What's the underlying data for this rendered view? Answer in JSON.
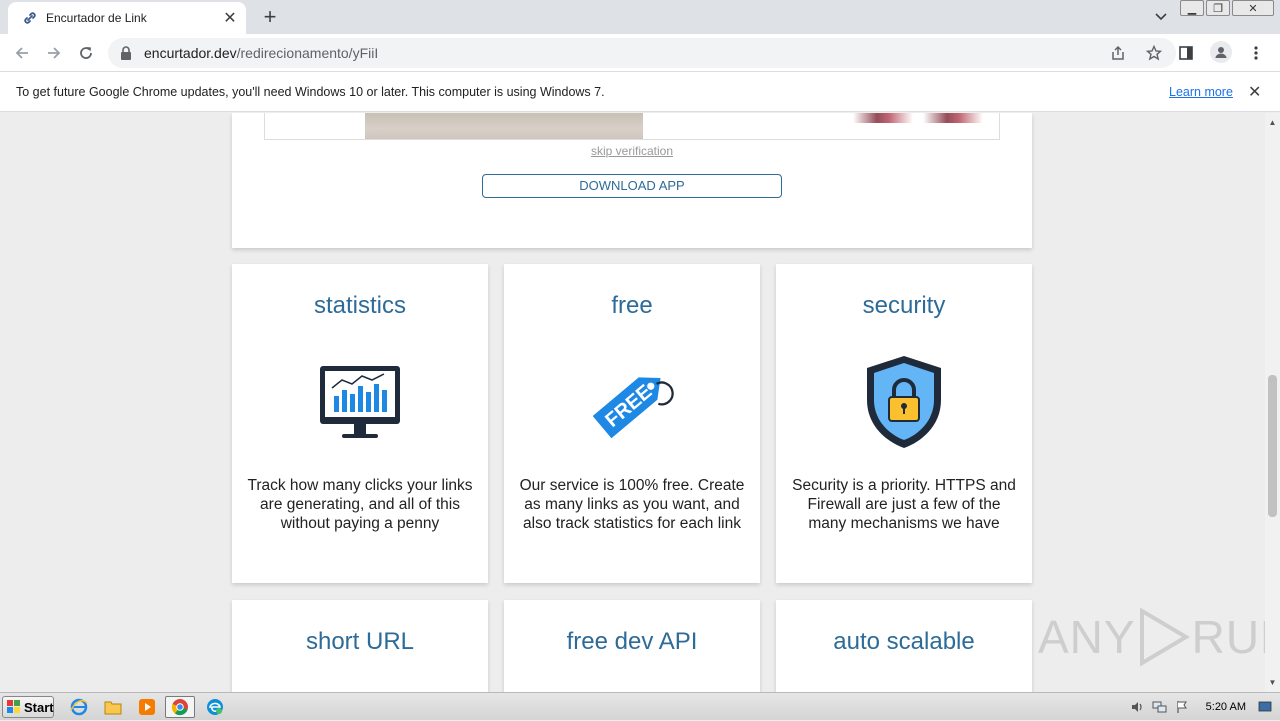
{
  "browser": {
    "tab_title": "Encurtador de Link",
    "url_host": "encurtador.dev",
    "url_path": "/redirecionamento/yFiiI",
    "info_message": "To get future Google Chrome updates, you'll need Windows 10 or later. This computer is using Windows 7.",
    "learn_more": "Learn more"
  },
  "page": {
    "skip_link": "skip verification",
    "download_button": "DOWNLOAD APP",
    "features": [
      {
        "title": "statistics",
        "description": "Track how many clicks your links are generating, and all of this without paying a penny",
        "icon": "monitor-chart-icon"
      },
      {
        "title": "free",
        "description": "Our service is 100% free. Create as many links as you want, and also track statistics for each link",
        "icon": "free-tag-icon",
        "icon_text": "FREE"
      },
      {
        "title": "security",
        "description": "Security is a priority. HTTPS and Firewall are just a few of the many mechanisms we have",
        "icon": "shield-lock-icon"
      },
      {
        "title": "short URL",
        "icon": "link-icon"
      },
      {
        "title": "free dev API",
        "icon": "api-icon"
      },
      {
        "title": "auto scalable",
        "icon": "scale-icon"
      }
    ],
    "accent_color": "#2d6b98"
  },
  "watermark": {
    "left": "ANY",
    "right": "RUN"
  },
  "taskbar": {
    "start_label": "Start",
    "time": "5:20 AM"
  }
}
